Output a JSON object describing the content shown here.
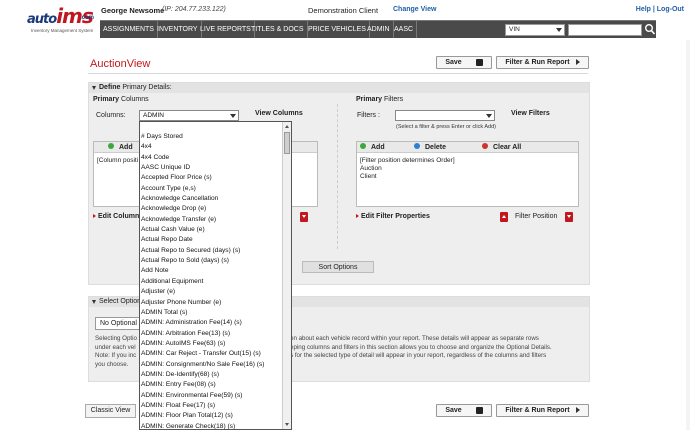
{
  "header": {
    "logo": "autoims.com",
    "logo_tagline": "Inventory Management System",
    "user_name": "George Newsome",
    "ip": "(IP: 204.77.233.122)",
    "client": "Demonstration Client",
    "change_view": "Change View",
    "help_logout": "Help | Log-Out",
    "nav": [
      "ASSIGNMENTS",
      "INVENTORY",
      "LIVE REPORTS",
      "TITLES & DOCS",
      "PRICE VEHICLES",
      "ADMIN",
      "AASC"
    ],
    "search_type": "VIN"
  },
  "page": {
    "title": "AuctionView",
    "save_label": "Save",
    "filter_run_label": "Filter & Run Report",
    "classic_view_label": "Classic View"
  },
  "define": {
    "header_bold": "Define",
    "header_rest": " Primary Details:",
    "columns_head_bold": "Primary",
    "columns_head_rest": " Columns",
    "columns_label": "Columns:",
    "columns_value": "ADMIN",
    "view_columns": "View Columns",
    "columns_add": "Add",
    "columns_box_text": "[Column positi",
    "edit_column_label": "Edit Column P",
    "filters_head_bold": "Primary",
    "filters_head_rest": " Filters",
    "filters_label": "Filters :",
    "filters_value": "",
    "filters_hint": "(Select a filter & press Enter or click Add)",
    "view_filters": "View Filters",
    "filters_add": "Add",
    "filters_delete": "Delete",
    "filters_clear": "Clear All",
    "filters_box_lines": [
      "[Filter position determines Order]",
      "Auction",
      "Client"
    ],
    "edit_filter_label": "Edit Filter Properties",
    "filter_position_label": "Filter Position",
    "sort_options": "Sort Options"
  },
  "optional": {
    "header": "Select Option",
    "select_value": "No Optional",
    "left_lines": [
      "Selecting Optio",
      "under each vel",
      "Note: If you inc",
      "you choose."
    ],
    "right_lines": [
      "on about each vehicle record within your report. These details will appear as separate rows",
      "eping columns and filters in this section allows you to choose and organize the Optional Details.",
      "s for the selected type of detail will appear in your report, regardless of the columns and filters"
    ]
  },
  "dropdown": {
    "items": [
      "# Days Stored",
      "4x4",
      "4x4 Code",
      "AASC Unique ID",
      "Accepted Floor Price (s)",
      "Account Type (e,s)",
      "Acknowledge Cancellation",
      "Acknowledge Drop (e)",
      "Acknowledge Transfer (e)",
      "Actual Cash Value (e)",
      "Actual Repo Date",
      "Actual Repo to Secured (days) (s)",
      "Actual Repo to Sold (days) (s)",
      "Add Note",
      "Additional Equipment",
      "Adjuster (e)",
      "Adjuster Phone Number (e)",
      "ADMIN Total (s)",
      "ADMIN: Administration Fee(14) (s)",
      "ADMIN: Arbitration Fee(13) (s)",
      "ADMIN: AutoIMS Fee(63) (s)",
      "ADMIN: Car Reject - Transfer Out(15) (s)",
      "ADMIN: Consignment/No Sale Fee(16) (s)",
      "ADMIN: De-Identify(68) (s)",
      "ADMIN: Entry Fee(08) (s)",
      "ADMIN: Environmental Fee(59) (s)",
      "ADMIN: Float Fee(17) (s)",
      "ADMIN: Floor Plan Total(12) (s)",
      "ADMIN: Generate Check(18) (s)"
    ]
  },
  "colors": {
    "brand_red": "#c0181e",
    "link_blue": "#1f5fa8",
    "nav_bg": "#4a4a4a"
  }
}
